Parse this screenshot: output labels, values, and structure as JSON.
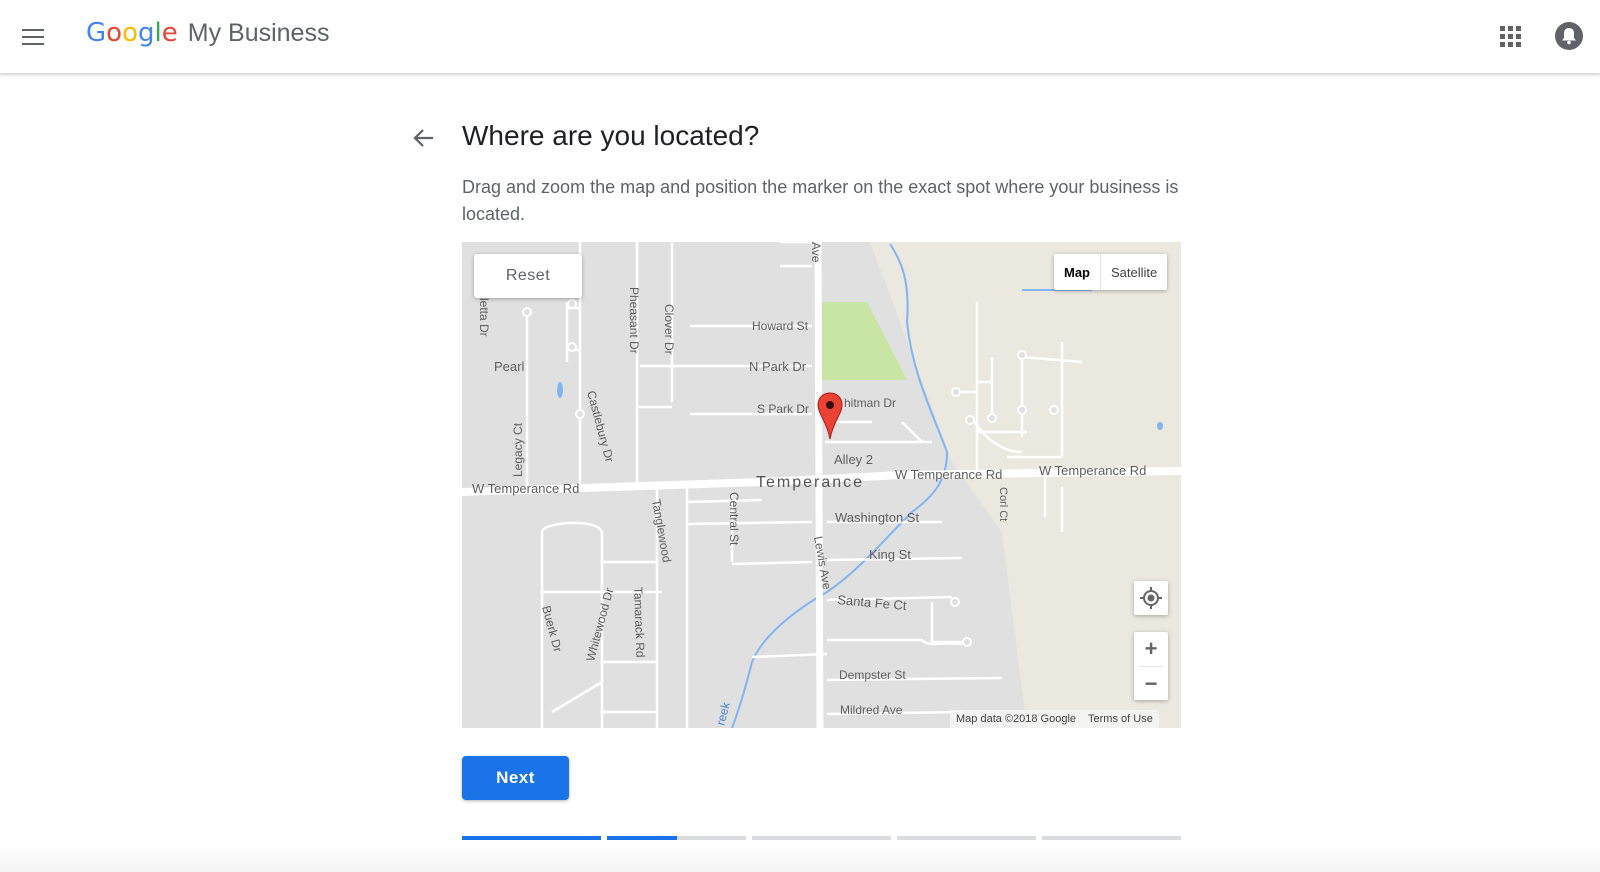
{
  "header": {
    "brand_letters": [
      {
        "ch": "G",
        "color": "#4285F4"
      },
      {
        "ch": "o",
        "color": "#EA4335"
      },
      {
        "ch": "o",
        "color": "#FBBC05"
      },
      {
        "ch": "g",
        "color": "#4285F4"
      },
      {
        "ch": "l",
        "color": "#34A853"
      },
      {
        "ch": "e",
        "color": "#EA4335"
      }
    ],
    "product_name": "My Business",
    "menu_icon": "hamburger-menu-icon",
    "apps_icon": "apps-grid-icon",
    "notifications_icon": "notification-bell-icon"
  },
  "page": {
    "title": "Where are you located?",
    "subtitle": "Drag and zoom the map and position the marker on the exact spot where your business is located.",
    "back_icon": "back-arrow-icon"
  },
  "map": {
    "reset_label": "Reset",
    "map_type_active": "Map",
    "map_type_other": "Satellite",
    "zoom_in": "+",
    "zoom_out": "−",
    "attribution": "Map data ©2018 Google",
    "terms": "Terms of Use",
    "labels": {
      "howard": "Howard St",
      "npark": "N Park Dr",
      "spark": "S Park Dr",
      "whitman": "hitman Dr",
      "alley": "Alley 2",
      "town": "Temperance",
      "wtemp1": "W Temperance Rd",
      "wtemp2": "W Temperance Rd",
      "wtemp3": "W Temperance Rd",
      "washington": "Washington St",
      "king": "King St",
      "santafe": "Santa Fe Ct",
      "dempster": "Dempster St",
      "mildred": "Mildred Ave",
      "pearl": "Pearl",
      "pheasant": "Pheasant Dr",
      "clover": "Clover Dr",
      "castlebury": "Castlebury Dr",
      "legacy": "Legacy Ct",
      "tanglewood": "Tanglewood",
      "central": "Central St",
      "lewis": "Lewis Ave",
      "corl": "Corl Ct",
      "buerk": "Buerk Dr",
      "whitewood": "Whitewood Dr",
      "tamarack": "Tamarack Rd",
      "etta": "letta Dr",
      "ave_top": "Ave",
      "creek": "reek"
    },
    "colors": {
      "land": "#e0e0e0",
      "farmland": "#ebe9df",
      "park": "#c8e5a3",
      "water": "#80b4f2",
      "road": "#ffffff",
      "marker": "#ea4335"
    }
  },
  "footer": {
    "next_label": "Next",
    "progress_steps": [
      1.0,
      0.5,
      0,
      0,
      0
    ],
    "accent": "#1a73e8"
  }
}
